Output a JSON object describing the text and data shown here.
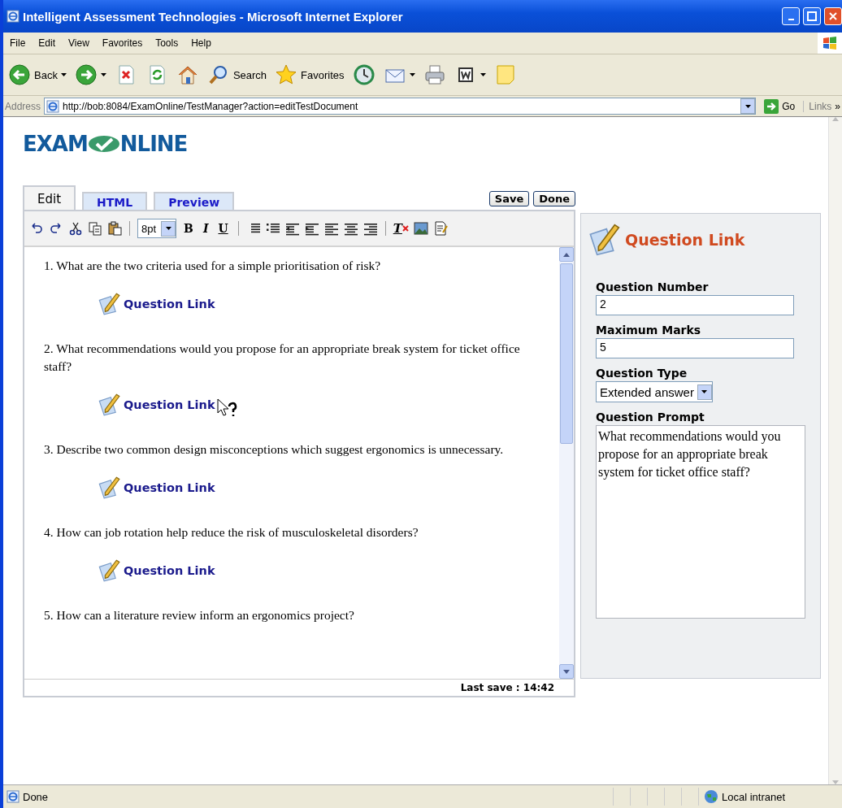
{
  "window": {
    "title": "Intelligent Assessment Technologies - Microsoft Internet Explorer"
  },
  "menu": [
    {
      "label": "File"
    },
    {
      "label": "Edit"
    },
    {
      "label": "View"
    },
    {
      "label": "Favorites"
    },
    {
      "label": "Tools"
    },
    {
      "label": "Help"
    }
  ],
  "toolbar": [
    {
      "kind": "back",
      "label": "Back",
      "dropdown": true
    },
    {
      "kind": "forward",
      "dropdown": true
    },
    {
      "kind": "stop"
    },
    {
      "kind": "refresh"
    },
    {
      "kind": "home"
    },
    {
      "kind": "search",
      "label": "Search"
    },
    {
      "kind": "favorites",
      "label": "Favorites"
    },
    {
      "kind": "history"
    },
    {
      "kind": "mail",
      "dropdown": true
    },
    {
      "kind": "print"
    },
    {
      "kind": "edit",
      "dropdown": true
    },
    {
      "kind": "notes"
    }
  ],
  "address": {
    "label": "Address",
    "url": "http://bob:8084/ExamOnline/TestManager?action=editTestDocument",
    "go": "Go",
    "links": "Links",
    "more": "»"
  },
  "logo": {
    "left": "EXAM",
    "right": "NLINE"
  },
  "tabs": [
    {
      "label": "Edit",
      "selected": true
    },
    {
      "label": "HTML",
      "selected": false
    },
    {
      "label": "Preview",
      "selected": false
    }
  ],
  "buttons": [
    {
      "label": "Save"
    },
    {
      "label": "Done"
    }
  ],
  "editor_tools": [
    {
      "kind": "undo"
    },
    {
      "kind": "redo"
    },
    {
      "kind": "cut"
    },
    {
      "kind": "copy"
    },
    {
      "kind": "paste"
    },
    {
      "kind": "sep"
    },
    {
      "kind": "select",
      "label": "8pt"
    },
    {
      "kind": "bold",
      "label": "B"
    },
    {
      "kind": "italic",
      "label": "I"
    },
    {
      "kind": "underline",
      "label": "U"
    },
    {
      "kind": "sep"
    },
    {
      "kind": "numbered"
    },
    {
      "kind": "bullets"
    },
    {
      "kind": "outdent"
    },
    {
      "kind": "indent"
    },
    {
      "kind": "left"
    },
    {
      "kind": "center"
    },
    {
      "kind": "right"
    },
    {
      "kind": "sep"
    },
    {
      "kind": "clear",
      "label": "T"
    },
    {
      "kind": "image"
    },
    {
      "kind": "form"
    }
  ],
  "questions": [
    {
      "text": "1. What are the two criteria used for a simple prioritisation of risk?",
      "link": "Question Link",
      "hovered": false
    },
    {
      "text": "2. What recommendations would you propose for an appropriate break system for ticket office staff?",
      "link": "Question Link",
      "hovered": true
    },
    {
      "text": "3. Describe two common design misconceptions which suggest ergonomics is unnecessary.",
      "link": "Question Link",
      "hovered": false
    },
    {
      "text": "4. How can job rotation help reduce the risk of musculoskeletal disorders?",
      "link": "Question Link",
      "hovered": false
    },
    {
      "text": "5. How can a literature review inform an ergonomics project?"
    }
  ],
  "editor_status": "Last save : 14:42",
  "panel": {
    "title": "Question Link",
    "fields": [
      {
        "kind": "text",
        "label": "Question Number",
        "value": "2"
      },
      {
        "kind": "text",
        "label": "Maximum Marks",
        "value": "5"
      },
      {
        "kind": "select",
        "label": "Question Type",
        "value": "Extended answer"
      },
      {
        "kind": "textarea",
        "label": "Question Prompt",
        "value": "What recommendations would you propose for an appropriate break system for ticket office staff?"
      }
    ]
  },
  "status_bar": {
    "text": "Done",
    "zone": "Local intranet"
  }
}
